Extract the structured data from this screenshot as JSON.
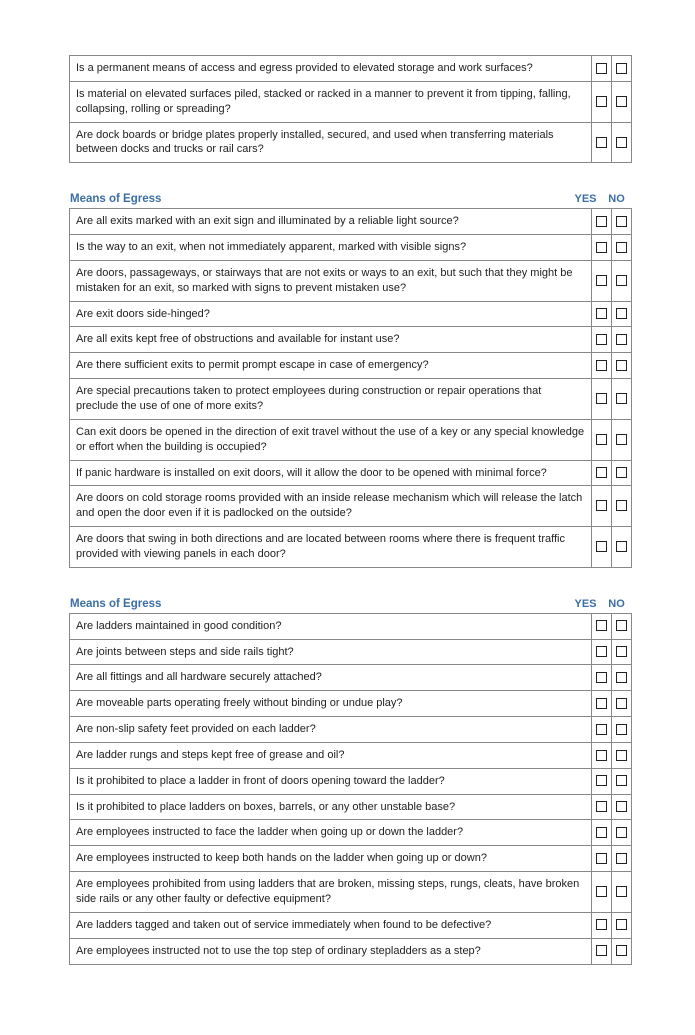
{
  "columns": {
    "yes": "YES",
    "no": "NO"
  },
  "sections": [
    {
      "title": "",
      "show_header": false,
      "items": [
        "Is a permanent means of access and egress provided to elevated storage and work surfaces?",
        "Is material on elevated surfaces piled, stacked or racked in a manner to prevent it from tipping, falling, collapsing, rolling or spreading?",
        "Are dock boards or bridge plates properly installed, secured, and used when transferring materials between docks and trucks or rail cars?"
      ]
    },
    {
      "title": "Means of Egress",
      "show_header": true,
      "items": [
        "Are all exits marked with an exit sign and illuminated by a reliable light source?",
        "Is the way to an exit, when not immediately apparent, marked with visible signs?",
        "Are doors, passageways, or stairways that are not exits or ways to an exit, but such that they might be mistaken for an exit, so marked with signs to prevent mistaken use?",
        "Are exit doors side-hinged?",
        "Are all exits kept free of obstructions and available for instant use?",
        "Are there sufficient exits to permit prompt escape in case of emergency?",
        "Are special precautions taken to protect employees during construction or repair operations that preclude the use of one of more exits?",
        "Can exit doors be opened in the direction of exit travel without the use of a key or any special knowledge or effort when the building is occupied?",
        "If panic hardware is installed on exit doors, will it allow the door to be opened with minimal force?",
        "Are doors on cold storage rooms provided with an inside release mechanism which will release the latch and open the door even if it is padlocked on the outside?",
        "Are doors that swing in both directions and are located between rooms where there is frequent traffic provided with viewing panels in each door?"
      ]
    },
    {
      "title": "Means of Egress",
      "show_header": true,
      "items": [
        "Are ladders maintained in good condition?",
        "Are joints between steps and side rails tight?",
        "Are all fittings and all hardware securely attached?",
        "Are moveable parts operating freely without binding or undue play?",
        "Are non-slip safety feet provided on each ladder?",
        "Are ladder rungs and steps kept free of grease and oil?",
        "Is it prohibited to place a ladder in front of doors opening toward the ladder?",
        "Is it prohibited to place ladders on boxes, barrels, or any other unstable base?",
        "Are employees instructed to face the ladder when going up or down the ladder?",
        "Are employees instructed to keep both hands on the ladder when going up or down?",
        "Are employees prohibited from using ladders that are broken, missing steps, rungs, cleats, have broken side rails or any other faulty or defective equipment?",
        "Are ladders tagged and taken out of service immediately when found to be defective?",
        "Are employees instructed not to use the top step of ordinary stepladders as a step?"
      ]
    }
  ]
}
